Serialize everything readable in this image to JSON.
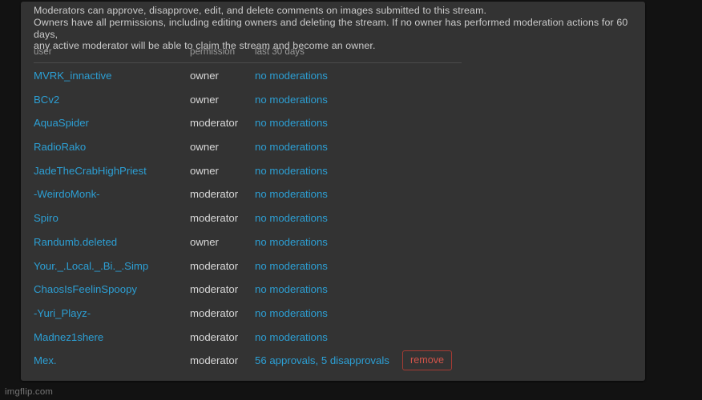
{
  "panel": {
    "description_lines": [
      "Moderators can approve, disapprove, edit, and delete comments on images submitted to this stream.",
      "Owners have all permissions, including editing owners and deleting the stream. If no owner has performed moderation actions for 60 days,",
      "any active moderator will be able to claim the stream and become an owner."
    ]
  },
  "table": {
    "headers": {
      "user": "user",
      "permission": "permission",
      "last_30_days": "last 30 days"
    },
    "rows": [
      {
        "user": "MVRK_innactive",
        "permission": "owner",
        "last_30_days": "no moderations",
        "action": ""
      },
      {
        "user": "BCv2",
        "permission": "owner",
        "last_30_days": "no moderations",
        "action": ""
      },
      {
        "user": "AquaSpider",
        "permission": "moderator",
        "last_30_days": "no moderations",
        "action": ""
      },
      {
        "user": "RadioRako",
        "permission": "owner",
        "last_30_days": "no moderations",
        "action": ""
      },
      {
        "user": "JadeTheCrabHighPriest",
        "permission": "owner",
        "last_30_days": "no moderations",
        "action": ""
      },
      {
        "user": "-WeirdoMonk-",
        "permission": "moderator",
        "last_30_days": "no moderations",
        "action": ""
      },
      {
        "user": "Spiro",
        "permission": "moderator",
        "last_30_days": "no moderations",
        "action": ""
      },
      {
        "user": "Randumb.deleted",
        "permission": "owner",
        "last_30_days": "no moderations",
        "action": ""
      },
      {
        "user": "Your._.Local._.Bi._.Simp",
        "permission": "moderator",
        "last_30_days": "no moderations",
        "action": ""
      },
      {
        "user": "ChaosIsFeelinSpoopy",
        "permission": "moderator",
        "last_30_days": "no moderations",
        "action": ""
      },
      {
        "user": "-Yuri_Playz-",
        "permission": "moderator",
        "last_30_days": "no moderations",
        "action": ""
      },
      {
        "user": "Madnez1shere",
        "permission": "moderator",
        "last_30_days": "no moderations",
        "action": ""
      },
      {
        "user": "Mex.",
        "permission": "moderator",
        "last_30_days": "56 approvals, 5 disapprovals",
        "action": "remove"
      }
    ]
  },
  "watermark": "imgflip.com",
  "colors": {
    "link_blue": "#2c9fd4",
    "panel_bg": "#333333",
    "page_bg": "#121212",
    "remove_red": "#d4544a",
    "remove_border": "#a63b33",
    "header_gray": "#9a9a9a",
    "body_text": "#d8d8d8"
  }
}
